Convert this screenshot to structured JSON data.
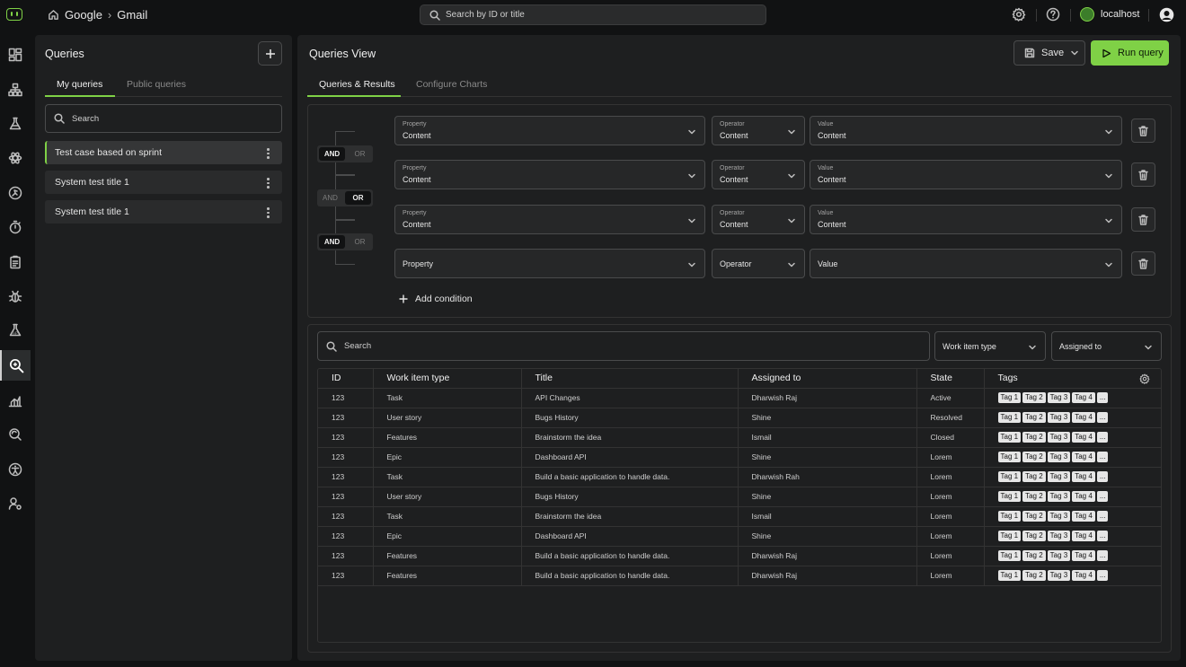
{
  "topbar": {
    "breadcrumb": [
      "Google",
      "Gmail"
    ],
    "search_placeholder": "Search by ID or title",
    "host": "localhost"
  },
  "rail": {
    "icons": [
      "dashboard-icon",
      "hierarchy-icon",
      "flask-icon",
      "atom-icon",
      "run-icon",
      "timer-icon",
      "clipboard-icon",
      "bug-icon",
      "api-icon",
      "query-search-icon",
      "chart-flow-icon",
      "search-sync-icon",
      "accessibility-icon",
      "person-settings-icon"
    ],
    "active_index": 9
  },
  "queries": {
    "title": "Queries",
    "tabs": [
      "My queries",
      "Public queries"
    ],
    "search_placeholder": "Search",
    "items": [
      "Test case based on sprint",
      "System test title 1",
      "System test title 1"
    ]
  },
  "main": {
    "title": "Queries View",
    "save_label": "Save",
    "run_label": "Run query",
    "tabs": [
      "Queries & Results",
      "Configure Charts"
    ]
  },
  "builder": {
    "rows": [
      {
        "property_label": "Property",
        "property": "Content",
        "operator_label": "Operator",
        "operator": "Content",
        "value_label": "Value",
        "value": "Content"
      },
      {
        "property_label": "Property",
        "property": "Content",
        "operator_label": "Operator",
        "operator": "Content",
        "value_label": "Value",
        "value": "Content"
      },
      {
        "property_label": "Property",
        "property": "Content",
        "operator_label": "Operator",
        "operator": "Content",
        "value_label": "Value",
        "value": "Content"
      },
      {
        "property_placeholder": "Property",
        "operator_placeholder": "Operator",
        "value_placeholder": "Value"
      }
    ],
    "logic": [
      {
        "and": "AND",
        "or": "OR",
        "active": "AND"
      },
      {
        "and": "AND",
        "or": "OR",
        "active": "OR"
      },
      {
        "and": "AND",
        "or": "OR",
        "active": "AND"
      }
    ],
    "add_condition": "Add condition"
  },
  "results": {
    "search_placeholder": "Search",
    "filter_work_item": "Work item type",
    "filter_assigned": "Assigned to",
    "columns": [
      "ID",
      "Work item type",
      "Title",
      "Assigned to",
      "State",
      "Tags"
    ],
    "tags": [
      "Tag 1",
      "Tag 2",
      "Tag 3",
      "Tag 4",
      "..."
    ],
    "rows": [
      [
        "123",
        "Task",
        "API Changes",
        "Dharwish Raj",
        "Active"
      ],
      [
        "123",
        "User story",
        "Bugs History",
        "Shine",
        "Resolved"
      ],
      [
        "123",
        "Features",
        "Brainstorm the idea",
        "Ismail",
        "Closed"
      ],
      [
        "123",
        "Epic",
        "Dashboard API",
        "Shine",
        "Lorem"
      ],
      [
        "123",
        "Task",
        "Build a basic application to handle data.",
        "Dharwish Rah",
        "Lorem"
      ],
      [
        "123",
        "User story",
        "Bugs History",
        "Shine",
        "Lorem"
      ],
      [
        "123",
        "Task",
        "Brainstorm the idea",
        "Ismail",
        "Lorem"
      ],
      [
        "123",
        "Epic",
        "Dashboard API",
        "Shine",
        "Lorem"
      ],
      [
        "123",
        "Features",
        "Build a basic application to handle data.",
        "Dharwish Raj",
        "Lorem"
      ],
      [
        "123",
        "Features",
        "Build a basic application to handle data.",
        "Dharwish Raj",
        "Lorem"
      ]
    ]
  },
  "colors": {
    "accent": "#7fd146",
    "background": "#111213",
    "panel": "#1e1f20"
  }
}
